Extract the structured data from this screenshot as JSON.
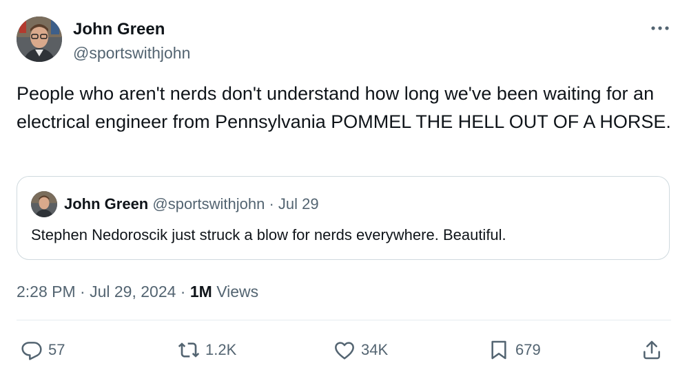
{
  "author": {
    "name": "John Green",
    "handle": "@sportswithjohn"
  },
  "tweet": {
    "text": "People who aren't nerds don't understand how long we've been waiting for an electrical engineer from Pennsylvania POMMEL THE HELL OUT OF A HORSE."
  },
  "quote": {
    "name": "John Green",
    "handle_date": "@sportswithjohn · Jul 29",
    "text": "Stephen Nedoroscik just struck a blow for nerds everywhere. Beautiful."
  },
  "meta": {
    "timestamp": "2:28 PM · Jul 29, 2024 · ",
    "views_count": "1M",
    "views_label": " Views"
  },
  "actions": {
    "replies": "57",
    "reposts": "1.2K",
    "likes": "34K",
    "bookmarks": "679"
  },
  "icons": [
    "more-icon",
    "reply-icon",
    "repost-icon",
    "like-icon",
    "bookmark-icon",
    "share-icon"
  ],
  "colors": {
    "text": "#0f1419",
    "secondary": "#536471",
    "border": "#cfd9de"
  }
}
